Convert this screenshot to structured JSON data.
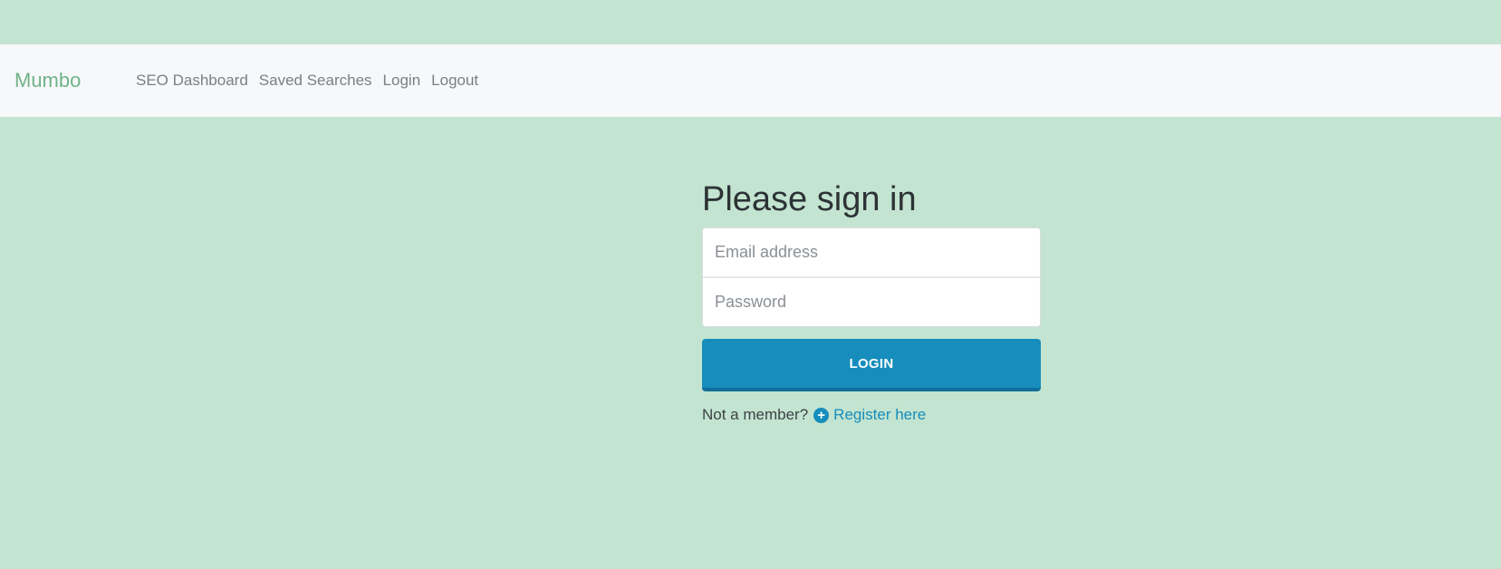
{
  "navbar": {
    "brand": "Mumbo",
    "links": [
      {
        "label": "SEO Dashboard"
      },
      {
        "label": "Saved Searches"
      },
      {
        "label": "Login"
      },
      {
        "label": "Logout"
      }
    ]
  },
  "signin": {
    "heading": "Please sign in",
    "email_placeholder": "Email address",
    "password_placeholder": "Password",
    "login_button": "LOGIN",
    "not_member_text": "Not a member?",
    "register_link": "Register here",
    "register_icon": "plus-circle-icon"
  },
  "colors": {
    "background": "#c3e4d0",
    "navbar": "#f7f8fa",
    "brand": "#6fb389",
    "accent": "#168dbc"
  }
}
